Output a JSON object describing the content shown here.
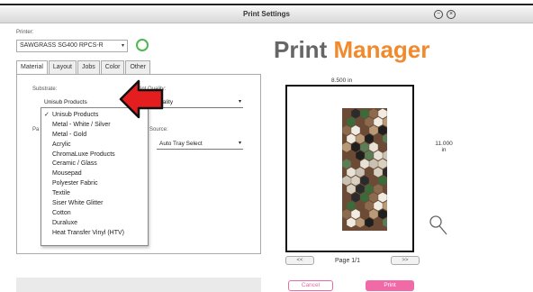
{
  "window": {
    "title": "Print Settings",
    "minimize_icon": "minimize-circle-icon",
    "close_icon": "close-circle-icon"
  },
  "printer": {
    "label": "Printer:",
    "value": "SAWGRASS SG400 RPCS-R",
    "status_color": "#4fb84f"
  },
  "tabs": [
    {
      "label": "Material",
      "active": true
    },
    {
      "label": "Layout",
      "active": false
    },
    {
      "label": "Jobs",
      "active": false
    },
    {
      "label": "Color",
      "active": false
    },
    {
      "label": "Other",
      "active": false
    }
  ],
  "material": {
    "substrate_label": "Substrate:",
    "substrate_value": "Unisub Products",
    "print_quality_label": "Print Quality:",
    "print_quality_value": "uality",
    "paper_label": "Pa",
    "source_label": "Source:",
    "source_value": "Auto Tray Select"
  },
  "substrate_options": [
    {
      "label": "Unisub Products",
      "checked": true
    },
    {
      "label": "Metal - White / Silver",
      "checked": false
    },
    {
      "label": "Metal - Gold",
      "checked": false
    },
    {
      "label": "Acrylic",
      "checked": false
    },
    {
      "label": "ChromaLuxe Products",
      "checked": false
    },
    {
      "label": "Ceramic / Glass",
      "checked": false
    },
    {
      "label": "Mousepad",
      "checked": false
    },
    {
      "label": "Polyester Fabric",
      "checked": false
    },
    {
      "label": "Textile",
      "checked": false
    },
    {
      "label": "Siser White Glitter",
      "checked": false
    },
    {
      "label": "Cotton",
      "checked": false
    },
    {
      "label": "Duraluxe",
      "checked": false
    },
    {
      "label": "Heat Transfer Vinyl (HTV)",
      "checked": false
    }
  ],
  "brand": {
    "part1": "Print ",
    "part2": "Manager",
    "color1": "#666666",
    "color2": "#f08a2c"
  },
  "preview": {
    "width_label": "8.500 in",
    "height_label": "11.000\nin",
    "page_label": "Page 1/1",
    "prev_label": "<<",
    "next_label": ">>",
    "zoom_icon": "zoom-magnifier-icon"
  },
  "actions": {
    "cancel_label": "Cancel",
    "print_label": "Print",
    "accent_color": "#f06aa8"
  },
  "annotation": {
    "arrow_color": "#e41e1e"
  }
}
